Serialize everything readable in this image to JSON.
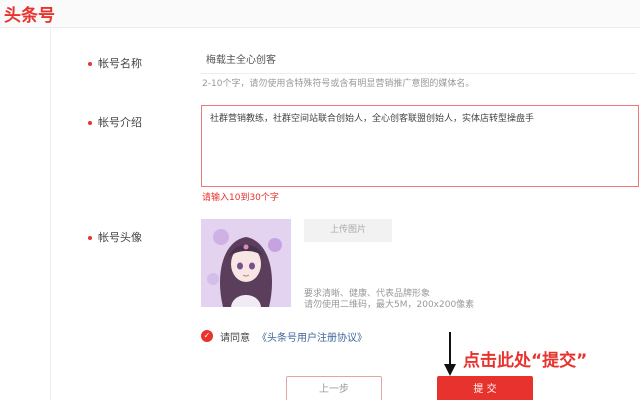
{
  "header": {
    "logo_text": "头条号"
  },
  "form": {
    "name": {
      "label": "帐号名称",
      "value": "梅载主全心创客",
      "hint": "2-10个字，请勿使用含特殊符号或含有明显营销推广意图的媒体名。"
    },
    "intro": {
      "label": "帐号介绍",
      "value": "社群营销教练，社群空间站联合创始人，全心创客联盟创始人，实体店转型操盘手",
      "error": "请输入10到30个字"
    },
    "avatar": {
      "label": "帐号头像",
      "upload_label": "上传图片",
      "requirements_line1": "要求清晰、健康、代表品牌形象",
      "requirements_line2": "请勿使用二维码，最大5M，200x200像素"
    },
    "agreement": {
      "prefix": "请同意",
      "link": "《头条号用户注册协议》",
      "checked": true
    }
  },
  "actions": {
    "prev_label": "上一步",
    "submit_label": "提 交"
  },
  "annotation": {
    "text": "点击此处“提交”"
  },
  "colors": {
    "accent": "#e8322d"
  }
}
